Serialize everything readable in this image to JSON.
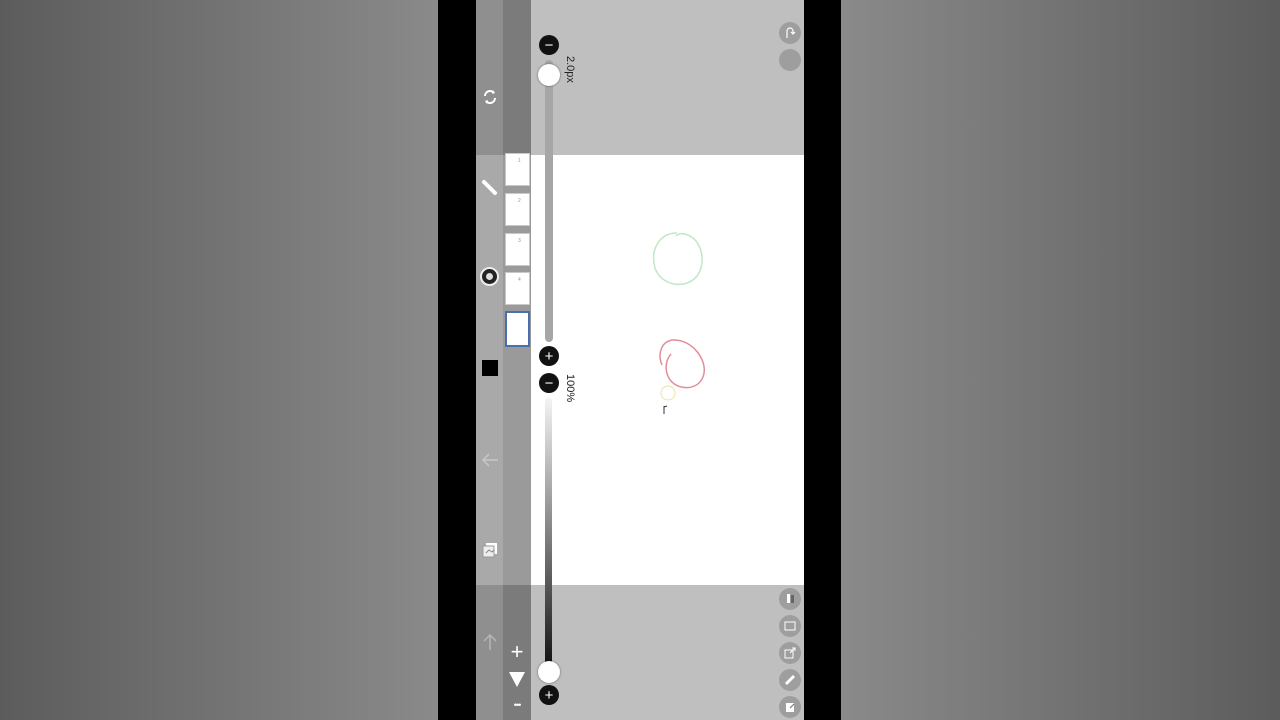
{
  "brush": {
    "size_label": "2.0px",
    "size_value": 2.0,
    "size_fraction": 0.02,
    "minus_label": "−",
    "plus_label": "+"
  },
  "opacity": {
    "label": "100%",
    "value": 100,
    "minus_label": "−",
    "plus_label": "+"
  },
  "tools": [
    {
      "name": "rotate-icon"
    },
    {
      "name": "pen-icon"
    },
    {
      "name": "brush-palette-icon"
    },
    {
      "name": "color-swatch",
      "color": "#000000"
    },
    {
      "name": "undo-arrow-icon"
    },
    {
      "name": "layers-icon"
    },
    {
      "name": "up-arrow-icon"
    }
  ],
  "frames": {
    "count": 5,
    "selected_index": 4,
    "labels": [
      "1",
      "2",
      "3",
      "4",
      ""
    ],
    "add_label": "+",
    "more_label": "•••"
  },
  "canvas": {
    "colors": {
      "green_circle": "#bfe8c4",
      "red_loop": "#e48c98",
      "yellow_dot": "#ece2a4"
    }
  },
  "right_buttons_top": [
    "redo-icon",
    "settings-circle-icon"
  ],
  "right_buttons_bottom": [
    "eraser-icon",
    "grid-icon",
    "reference-icon",
    "ruler-icon",
    "export-icon"
  ]
}
